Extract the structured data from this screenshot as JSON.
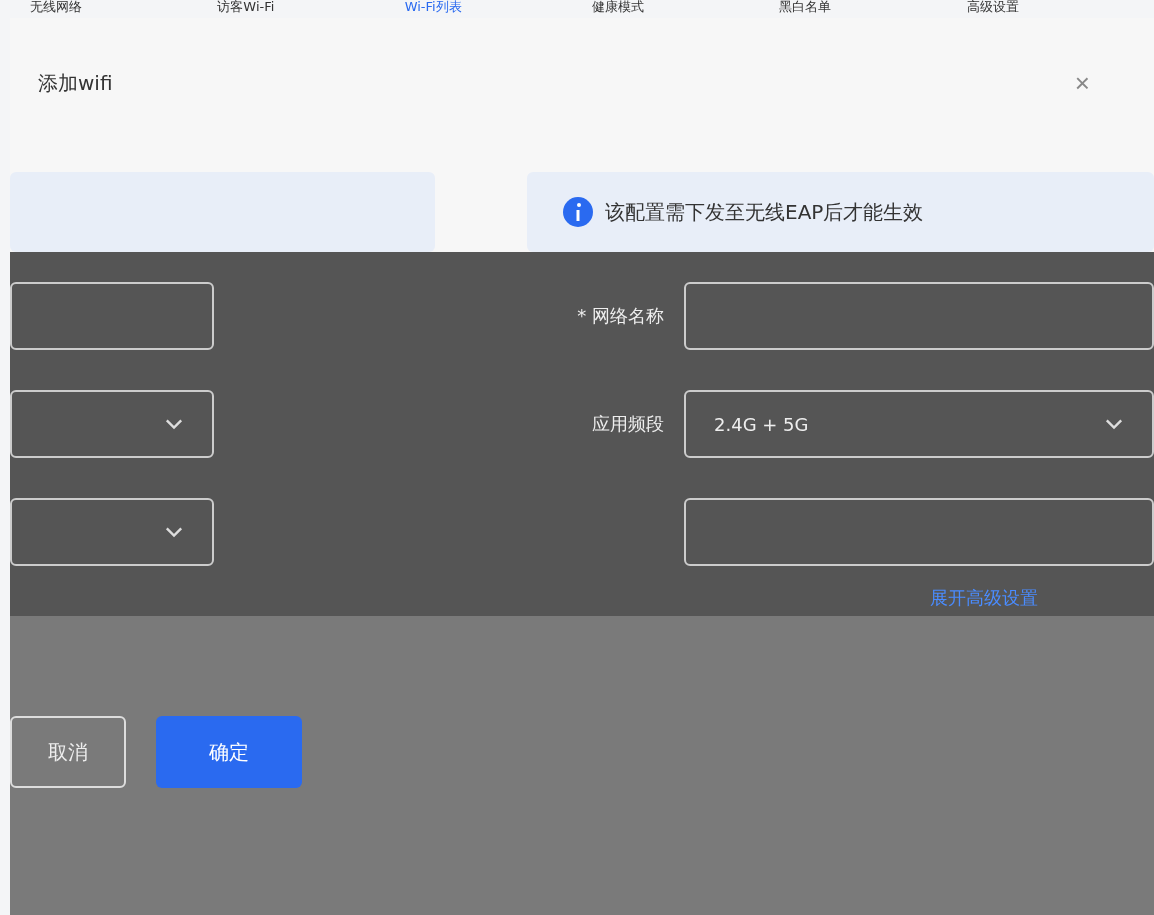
{
  "nav_tabs": [
    {
      "label": "无线网络",
      "selected": false
    },
    {
      "label": "访客Wi-Fi",
      "selected": false
    },
    {
      "label": "Wi-Fi列表",
      "selected": true
    },
    {
      "label": "健康模式",
      "selected": false
    },
    {
      "label": "黑白名单",
      "selected": false
    },
    {
      "label": "高级设置",
      "selected": false
    }
  ],
  "dialog": {
    "title": "添加wifi",
    "close": "×",
    "notice": "该配置需下发至无线EAP后才能生效",
    "left_fields": [
      {
        "kind": "input"
      },
      {
        "kind": "select"
      },
      {
        "kind": "select"
      }
    ],
    "right_fields": [
      {
        "kind": "input",
        "label": "* 网络名称"
      },
      {
        "kind": "select",
        "label": "应用频段",
        "value": "2.4G + 5G"
      },
      {
        "kind": "input"
      }
    ],
    "advanced_link": "展开高级设置",
    "buttons": [
      {
        "label": "取消",
        "kind": "secondary"
      },
      {
        "label": "确定",
        "kind": "primary"
      }
    ]
  }
}
